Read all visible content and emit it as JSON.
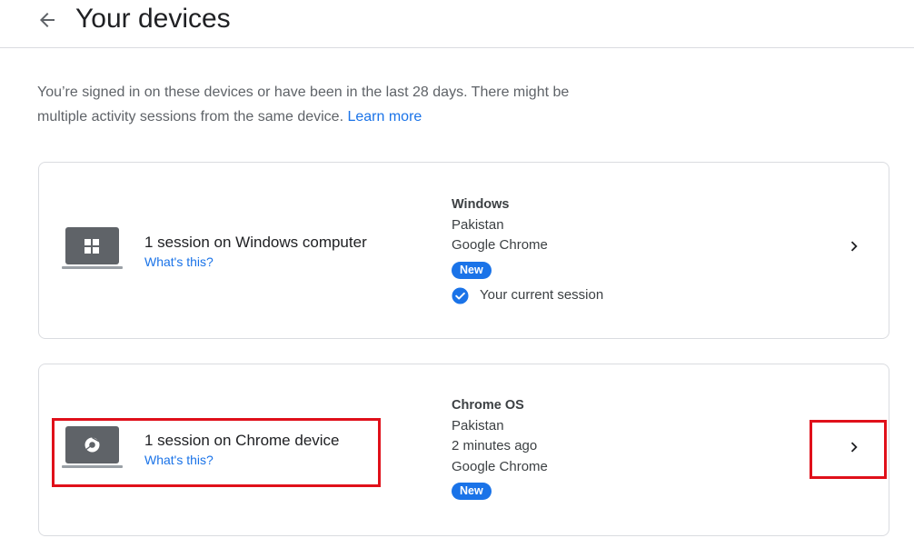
{
  "header": {
    "title": "Your devices",
    "back_icon": "arrow-back-icon"
  },
  "intro": {
    "text": "You’re signed in on these devices or have been in the last 28 days. There might be multiple activity sessions from the same device.",
    "learn_more": "Learn more"
  },
  "devices": [
    {
      "title": "1 session on Windows computer",
      "whats_this": "What's this?",
      "icon": "windows-laptop-icon",
      "os": "Windows",
      "location": "Pakistan",
      "browser": "Google Chrome",
      "badge": "New",
      "current_session": "Your current session"
    },
    {
      "title": "1 session on Chrome device",
      "whats_this": "What's this?",
      "icon": "chrome-laptop-icon",
      "os": "Chrome OS",
      "location": "Pakistan",
      "last_active": "2 minutes ago",
      "browser": "Google Chrome",
      "badge": "New"
    }
  ],
  "colors": {
    "link": "#1a73e8",
    "badge": "#1a73e8",
    "highlight": "#e0101a",
    "border": "#dadce0"
  }
}
